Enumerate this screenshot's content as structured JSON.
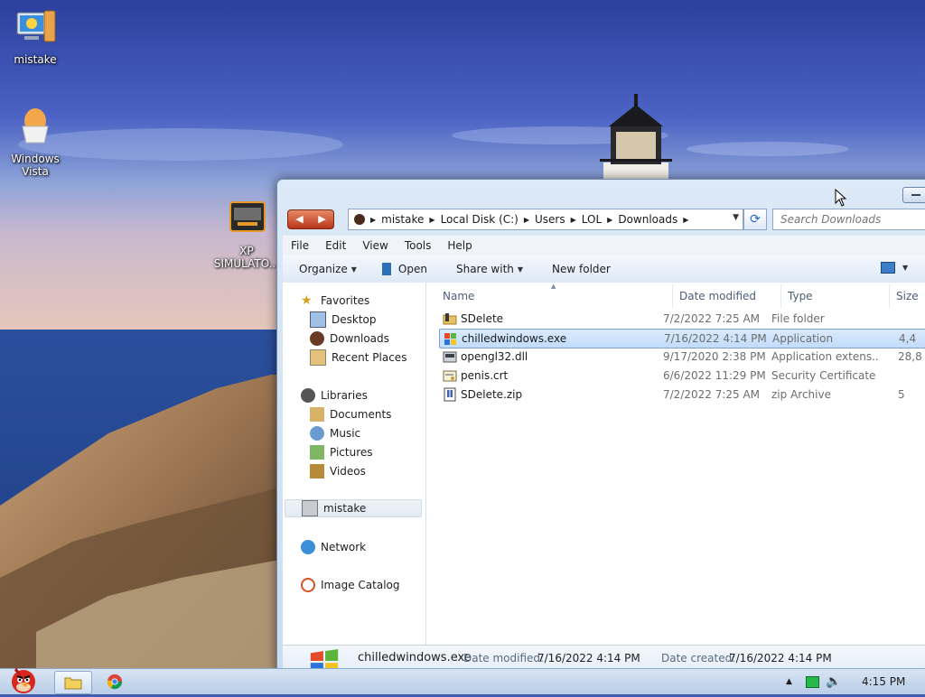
{
  "desktop": {
    "icons": [
      {
        "label": "mistake",
        "icon": "computer-icon"
      },
      {
        "label": "Windows Vista",
        "icon": "vista-egg-icon"
      },
      {
        "label": "XP SIMULATO...",
        "icon": "xp-simulator-icon"
      }
    ]
  },
  "window": {
    "address": {
      "crumbs": [
        "mistake",
        "Local Disk (C:)",
        "Users",
        "LOL",
        "Downloads"
      ]
    },
    "search": {
      "placeholder": "Search Downloads"
    },
    "menu": [
      "File",
      "Edit",
      "View",
      "Tools",
      "Help"
    ],
    "commands": {
      "organize": "Organize",
      "open": "Open",
      "share_with": "Share with",
      "new_folder": "New folder"
    },
    "nav": {
      "favorites": "Favorites",
      "desktop": "Desktop",
      "downloads": "Downloads",
      "recent_places": "Recent Places",
      "libraries": "Libraries",
      "documents": "Documents",
      "music": "Music",
      "pictures": "Pictures",
      "videos": "Videos",
      "computer": "mistake",
      "network": "Network",
      "image_catalog": "Image Catalog"
    },
    "columns": {
      "name": "Name",
      "date_modified": "Date modified",
      "type": "Type",
      "size": "Size"
    },
    "files": [
      {
        "name": "SDelete",
        "date": "7/2/2022 7:25 AM",
        "type": "File folder",
        "size": "",
        "icon": "folder-icon"
      },
      {
        "name": "chilledwindows.exe",
        "date": "7/16/2022 4:14 PM",
        "type": "Application",
        "size": "4,4",
        "icon": "windows-flag-icon"
      },
      {
        "name": "opengl32.dll",
        "date": "9/17/2020 2:38 PM",
        "type": "Application extens...",
        "size": "28,8",
        "icon": "dll-icon"
      },
      {
        "name": "penis.crt",
        "date": "6/6/2022 11:29 PM",
        "type": "Security Certificate",
        "size": "",
        "icon": "certificate-icon"
      },
      {
        "name": "SDelete.zip",
        "date": "7/2/2022 7:25 AM",
        "type": "zip Archive",
        "size": "5",
        "icon": "zip-icon"
      }
    ],
    "details": {
      "name": "chilledwindows.exe",
      "modified_label": "Date modified:",
      "modified": "7/16/2022 4:14 PM",
      "created_label": "Date created:",
      "created": "7/16/2022 4:14 PM"
    }
  },
  "taskbar": {
    "clock": "4:15 PM",
    "accent": "#1e6fd9"
  }
}
